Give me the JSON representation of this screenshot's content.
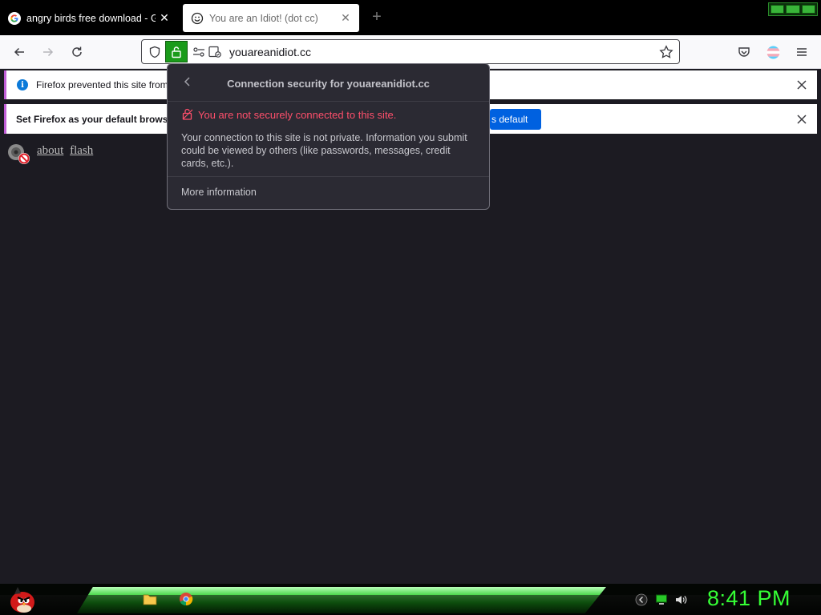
{
  "tabs": [
    {
      "label": "angry birds free download - Google",
      "close": "✕"
    },
    {
      "label": "You are an Idiot! (dot cc)",
      "close": "✕"
    }
  ],
  "new_tab": "+",
  "url": "youareanidiot.cc",
  "notifications": [
    {
      "text": "Firefox prevented this site from"
    },
    {
      "text": "Set Firefox as your default browse",
      "button": "s default"
    }
  ],
  "flash": {
    "about": "about",
    "flash": "flash"
  },
  "popup": {
    "title": "Connection security for youareanidiot.cc",
    "warning": "You are not securely connected to this site.",
    "description": "Your connection to this site is not private. Information you submit could be viewed by others (like passwords, messages, credit cards, etc.).",
    "more": "More information"
  },
  "taskbar": {
    "clock": "8:41 PM"
  },
  "colors": {
    "accent_green": "#35ff35",
    "warning_red": "#ff4f6b",
    "button_blue": "#0061e0"
  }
}
